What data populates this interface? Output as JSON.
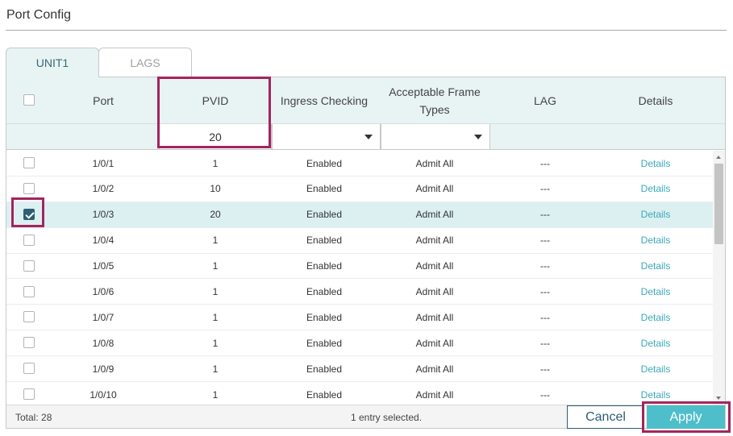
{
  "page": {
    "title": "Port Config"
  },
  "tabs": [
    {
      "label": "UNIT1",
      "active": true
    },
    {
      "label": "LAGS",
      "active": false
    }
  ],
  "columns": {
    "port": "Port",
    "pvid": "PVID",
    "ingress": "Ingress Checking",
    "acceptable": "Acceptable Frame Types",
    "lag": "LAG",
    "details": "Details"
  },
  "filter": {
    "pvid_value": "20",
    "ingress_value": "",
    "acceptable_value": ""
  },
  "rows": [
    {
      "port": "1/0/1",
      "pvid": "1",
      "ingress": "Enabled",
      "acceptable": "Admit All",
      "lag": "---",
      "details": "Details",
      "checked": false
    },
    {
      "port": "1/0/2",
      "pvid": "10",
      "ingress": "Enabled",
      "acceptable": "Admit All",
      "lag": "---",
      "details": "Details",
      "checked": false
    },
    {
      "port": "1/0/3",
      "pvid": "20",
      "ingress": "Enabled",
      "acceptable": "Admit All",
      "lag": "---",
      "details": "Details",
      "checked": true
    },
    {
      "port": "1/0/4",
      "pvid": "1",
      "ingress": "Enabled",
      "acceptable": "Admit All",
      "lag": "---",
      "details": "Details",
      "checked": false
    },
    {
      "port": "1/0/5",
      "pvid": "1",
      "ingress": "Enabled",
      "acceptable": "Admit All",
      "lag": "---",
      "details": "Details",
      "checked": false
    },
    {
      "port": "1/0/6",
      "pvid": "1",
      "ingress": "Enabled",
      "acceptable": "Admit All",
      "lag": "---",
      "details": "Details",
      "checked": false
    },
    {
      "port": "1/0/7",
      "pvid": "1",
      "ingress": "Enabled",
      "acceptable": "Admit All",
      "lag": "---",
      "details": "Details",
      "checked": false
    },
    {
      "port": "1/0/8",
      "pvid": "1",
      "ingress": "Enabled",
      "acceptable": "Admit All",
      "lag": "---",
      "details": "Details",
      "checked": false
    },
    {
      "port": "1/0/9",
      "pvid": "1",
      "ingress": "Enabled",
      "acceptable": "Admit All",
      "lag": "---",
      "details": "Details",
      "checked": false
    },
    {
      "port": "1/0/10",
      "pvid": "1",
      "ingress": "Enabled",
      "acceptable": "Admit All",
      "lag": "---",
      "details": "Details",
      "checked": false
    }
  ],
  "footer": {
    "total": "Total: 28",
    "selection": "1 entry selected."
  },
  "buttons": {
    "cancel": "Cancel",
    "apply": "Apply"
  },
  "colors": {
    "accent": "#4fbecb",
    "header_bg": "#e8f3f4",
    "link": "#3ba9b9",
    "highlight": "#a3245f",
    "selected_row": "#dcf0f2"
  },
  "icons": {
    "dropdown": "chevron-down-icon",
    "checkbox": "checkbox-icon",
    "scroll_up": "scroll-up-icon",
    "scroll_down": "scroll-down-icon"
  }
}
